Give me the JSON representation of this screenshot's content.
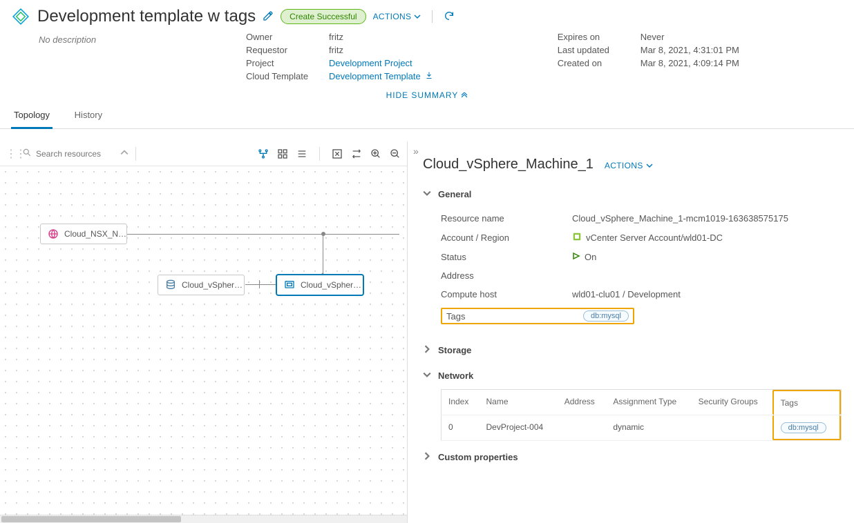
{
  "header": {
    "title": "Development template w tags",
    "status": "Create Successful",
    "actions_label": "ACTIONS",
    "no_description": "No description"
  },
  "summary": {
    "left": {
      "owner_lbl": "Owner",
      "owner_val": "fritz",
      "requestor_lbl": "Requestor",
      "requestor_val": "fritz",
      "project_lbl": "Project",
      "project_val": "Development Project",
      "template_lbl": "Cloud Template",
      "template_val": "Development Template"
    },
    "right": {
      "expires_lbl": "Expires on",
      "expires_val": "Never",
      "updated_lbl": "Last updated",
      "updated_val": "Mar 8, 2021, 4:31:01 PM",
      "created_lbl": "Created on",
      "created_val": "Mar 8, 2021, 4:09:14 PM"
    },
    "hide_label": "HIDE SUMMARY"
  },
  "tabs": {
    "topology": "Topology",
    "history": "History"
  },
  "canvas": {
    "search_placeholder": "Search resources",
    "nodes": {
      "nsx": "Cloud_NSX_N…",
      "vsphere1": "Cloud_vSpher…",
      "vsphere2": "Cloud_vSpher…"
    }
  },
  "details": {
    "resource_title": "Cloud_vSphere_Machine_1",
    "actions_label": "ACTIONS",
    "sections": {
      "general": {
        "title": "General",
        "resource_name_lbl": "Resource name",
        "resource_name_val": "Cloud_vSphere_Machine_1-mcm1019-163638575175",
        "account_lbl": "Account / Region",
        "account_val": "vCenter Server Account/wld01-DC",
        "status_lbl": "Status",
        "status_val": "On",
        "address_lbl": "Address",
        "address_val": "",
        "compute_lbl": "Compute host",
        "compute_val": "wld01-clu01 / Development",
        "tags_lbl": "Tags",
        "tags_val": "db:mysql"
      },
      "storage": {
        "title": "Storage"
      },
      "network": {
        "title": "Network",
        "columns": {
          "index": "Index",
          "name": "Name",
          "address": "Address",
          "assignment": "Assignment Type",
          "security": "Security Groups",
          "tags": "Tags"
        },
        "rows": [
          {
            "index": "0",
            "name": "DevProject-004",
            "address": "",
            "assignment": "dynamic",
            "security": "",
            "tags": "db:mysql"
          }
        ]
      },
      "custom": {
        "title": "Custom properties"
      }
    }
  }
}
